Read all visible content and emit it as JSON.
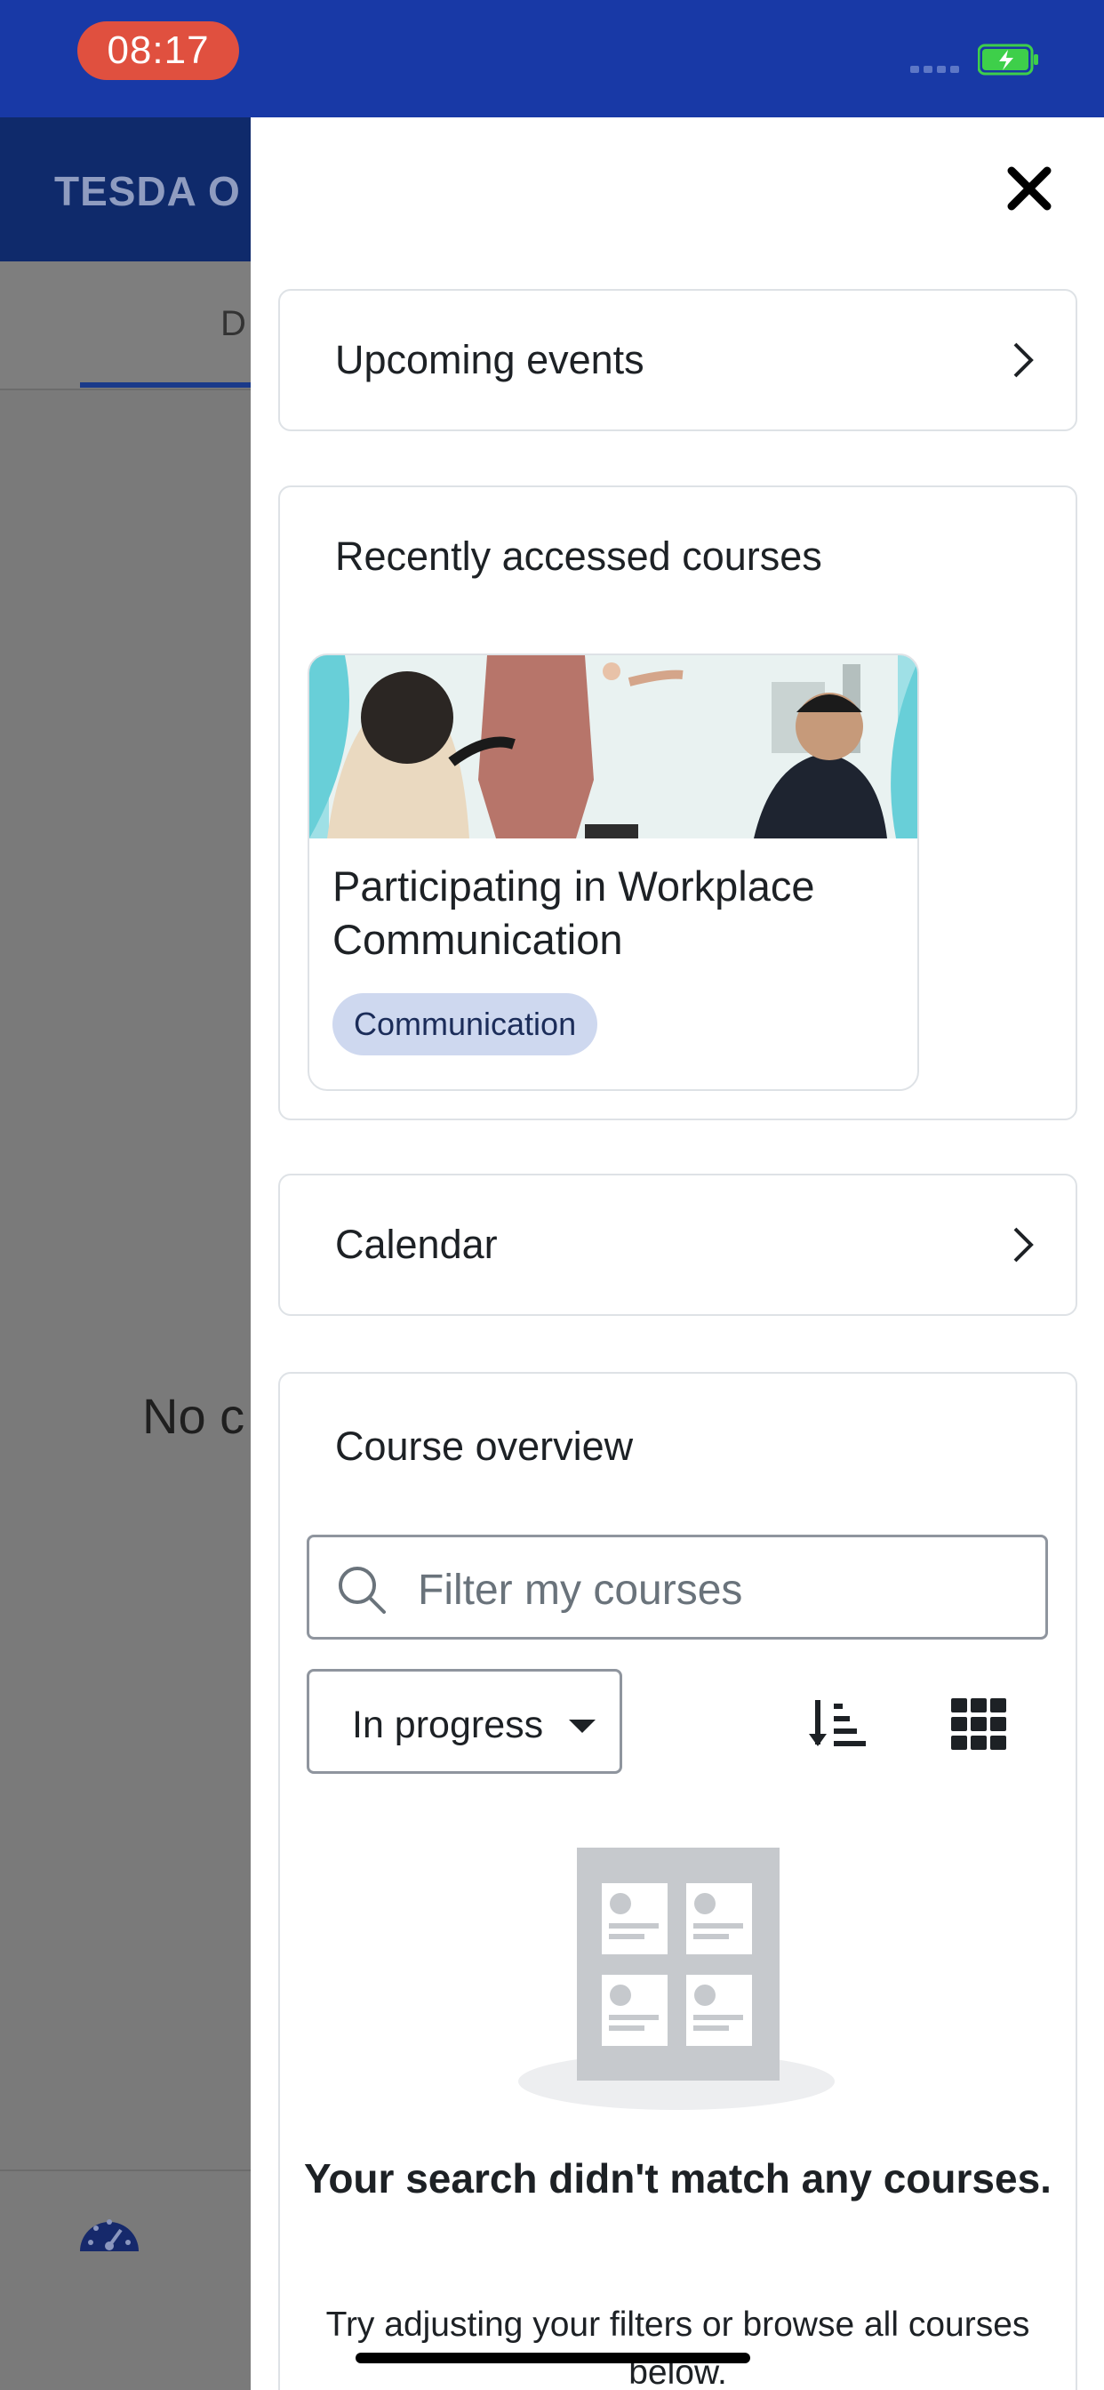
{
  "status_bar": {
    "time": "08:17",
    "signal_icon": "signal-bars-icon",
    "battery_icon": "battery-charging-icon",
    "colors": {
      "background": "#1839a6",
      "time_pill": "#e0503f",
      "battery_fill": "#3ecf4a"
    }
  },
  "background_app": {
    "title": "TESDA O",
    "tab_label": "D",
    "empty_message": "No c",
    "bottom_nav_icon": "dashboard-icon"
  },
  "drawer": {
    "close_icon": "close-icon",
    "upcoming_events": {
      "label": "Upcoming events",
      "icon": "chevron-right-icon"
    },
    "recent_courses": {
      "title": "Recently accessed courses",
      "courses": [
        {
          "name": "Participating in Workplace Communication",
          "category": "Communication"
        }
      ]
    },
    "calendar": {
      "label": "Calendar",
      "icon": "chevron-right-icon"
    },
    "course_overview": {
      "title": "Course overview",
      "search": {
        "placeholder": "Filter my courses",
        "icon": "search-icon"
      },
      "filter": {
        "selected": "In progress",
        "icon": "caret-down-icon"
      },
      "sort_icon": "sort-ascending-icon",
      "view_icon": "grid-view-icon",
      "empty_state": {
        "illustration": "empty-courses-illustration",
        "title": "Your search didn't match any courses.",
        "subtitle": "Try adjusting your filters or browse all courses below."
      }
    }
  },
  "colors": {
    "accent": "#0f2a6b",
    "badge_bg": "#ced8ef",
    "overlay": "#7a7a7a"
  }
}
